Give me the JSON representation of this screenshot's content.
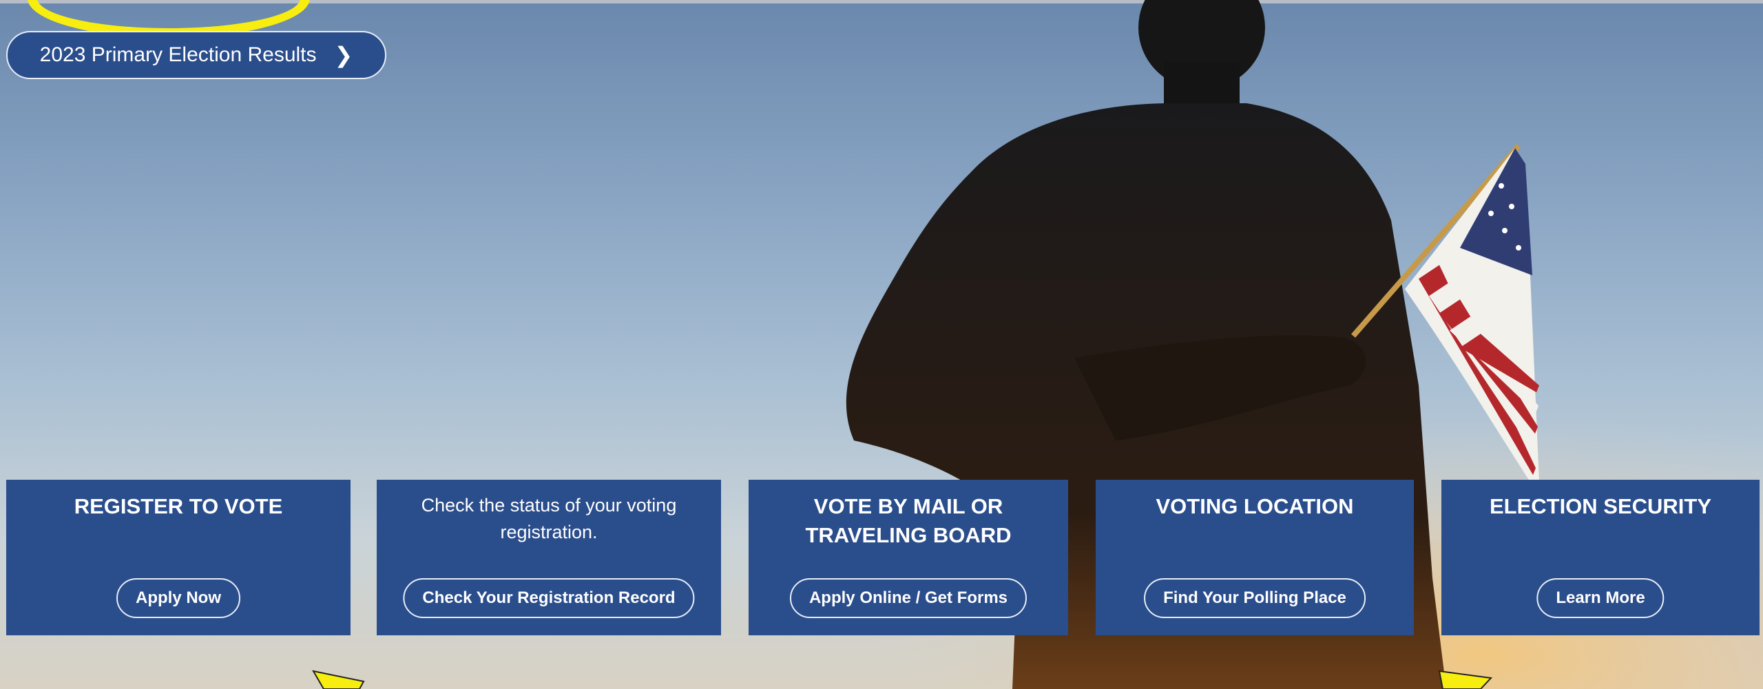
{
  "banner": {
    "results_label": "2023 Primary Election Results",
    "results_icon": "chevron-right-icon"
  },
  "cards": [
    {
      "title": "REGISTER TO VOTE",
      "button": "Apply Now"
    },
    {
      "description": "Check the status of your voting registration.",
      "button": "Check Your Registration Record"
    },
    {
      "title": "VOTE BY MAIL OR TRAVELING BOARD",
      "button": "Apply Online / Get Forms"
    },
    {
      "title": "VOTING LOCATION",
      "button": "Find Your Polling Place"
    },
    {
      "title": "ELECTION SECURITY",
      "button": "Learn More"
    }
  ],
  "colors": {
    "card_bg": "#2a4d8c",
    "annotation": "#f7ee10"
  }
}
